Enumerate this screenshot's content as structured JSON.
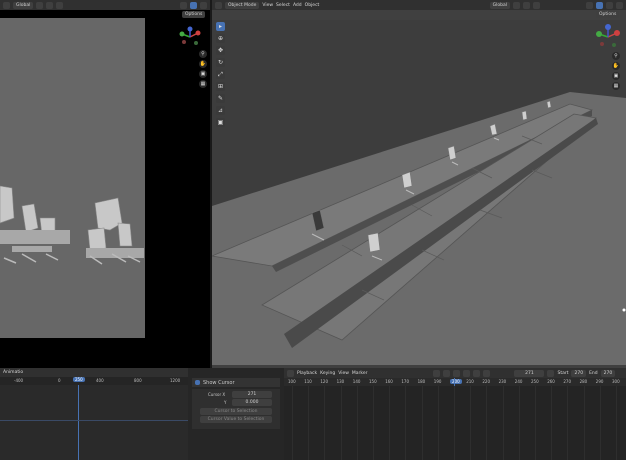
{
  "left_view": {
    "header": {
      "mode": "Global",
      "options": "Options"
    }
  },
  "main_view": {
    "header": {
      "mode": "Object Mode",
      "menu": [
        "View",
        "Select",
        "Add",
        "Object"
      ],
      "transform": "Global",
      "options": "Options"
    },
    "tools": [
      "select-box",
      "cursor",
      "move",
      "rotate",
      "scale",
      "transform",
      "annotate",
      "measure",
      "add-cube"
    ]
  },
  "left_timeline": {
    "editor": "Animatio",
    "ticks": [
      "-400",
      "0",
      "400",
      "800",
      "1200"
    ],
    "current_frame": "250"
  },
  "sidepanel": {
    "checkbox_label": "Show Cursor",
    "cursor_x_label": "Cursor X",
    "cursor_x_value": "271",
    "y_label": "Y",
    "y_value": "0.000",
    "btn1": "Cursor to Selection",
    "btn2": "Cursor Value to Selection"
  },
  "right_timeline": {
    "menu": [
      "Playback",
      "Keying",
      "View",
      "Marker"
    ],
    "frame_field": "271",
    "start_label": "Start",
    "start_value": "270",
    "end_label": "End",
    "end_value": "270",
    "ticks": [
      "100",
      "110",
      "120",
      "130",
      "140",
      "150",
      "160",
      "170",
      "180",
      "190",
      "200",
      "210",
      "220",
      "230",
      "240",
      "250",
      "260",
      "270",
      "280",
      "290",
      "300"
    ],
    "current_frame": "200"
  },
  "colors": {
    "accent": "#4772b3",
    "viewport": "#6f6f6f",
    "header": "#303030"
  }
}
